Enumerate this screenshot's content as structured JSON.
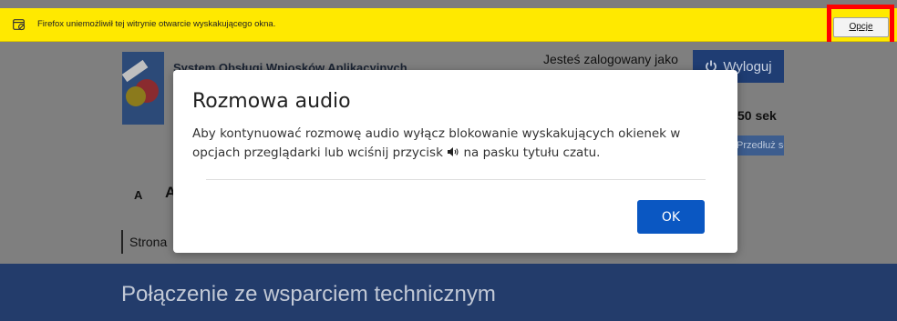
{
  "notification": {
    "message": "Firefox uniemożliwił tej witrynie otwarcie wyskakującego okna.",
    "options_label": "Opcje",
    "icon": "popup-blocked-icon"
  },
  "header": {
    "system_title": "System Obsługi Wniosków Aplikacyjnych",
    "logged_in_text": "Jesteś zalogowany jako",
    "logout_label": "Wyloguj",
    "session_time": "50 sek",
    "extend_session_label": "Przedłuż sesję"
  },
  "font_size": {
    "small": "A",
    "large": "A"
  },
  "breadcrumb": {
    "first": "Strona"
  },
  "hero": {
    "title": "Połączenie ze wsparciem technicznym"
  },
  "modal": {
    "title": "Rozmowa audio",
    "body_before_icon": "Aby kontynuować rozmowę audio wyłącz blokowanie wyskakujących okienek w opcjach przeglądarki lub wciśnij przycisk ",
    "body_after_icon": " na pasku tytułu czatu.",
    "ok_label": "OK"
  },
  "colors": {
    "notification_bg": "#ffe900",
    "highlight": "#ff0000",
    "primary_button": "#0a57c2",
    "hero_bg": "#233c6b"
  }
}
